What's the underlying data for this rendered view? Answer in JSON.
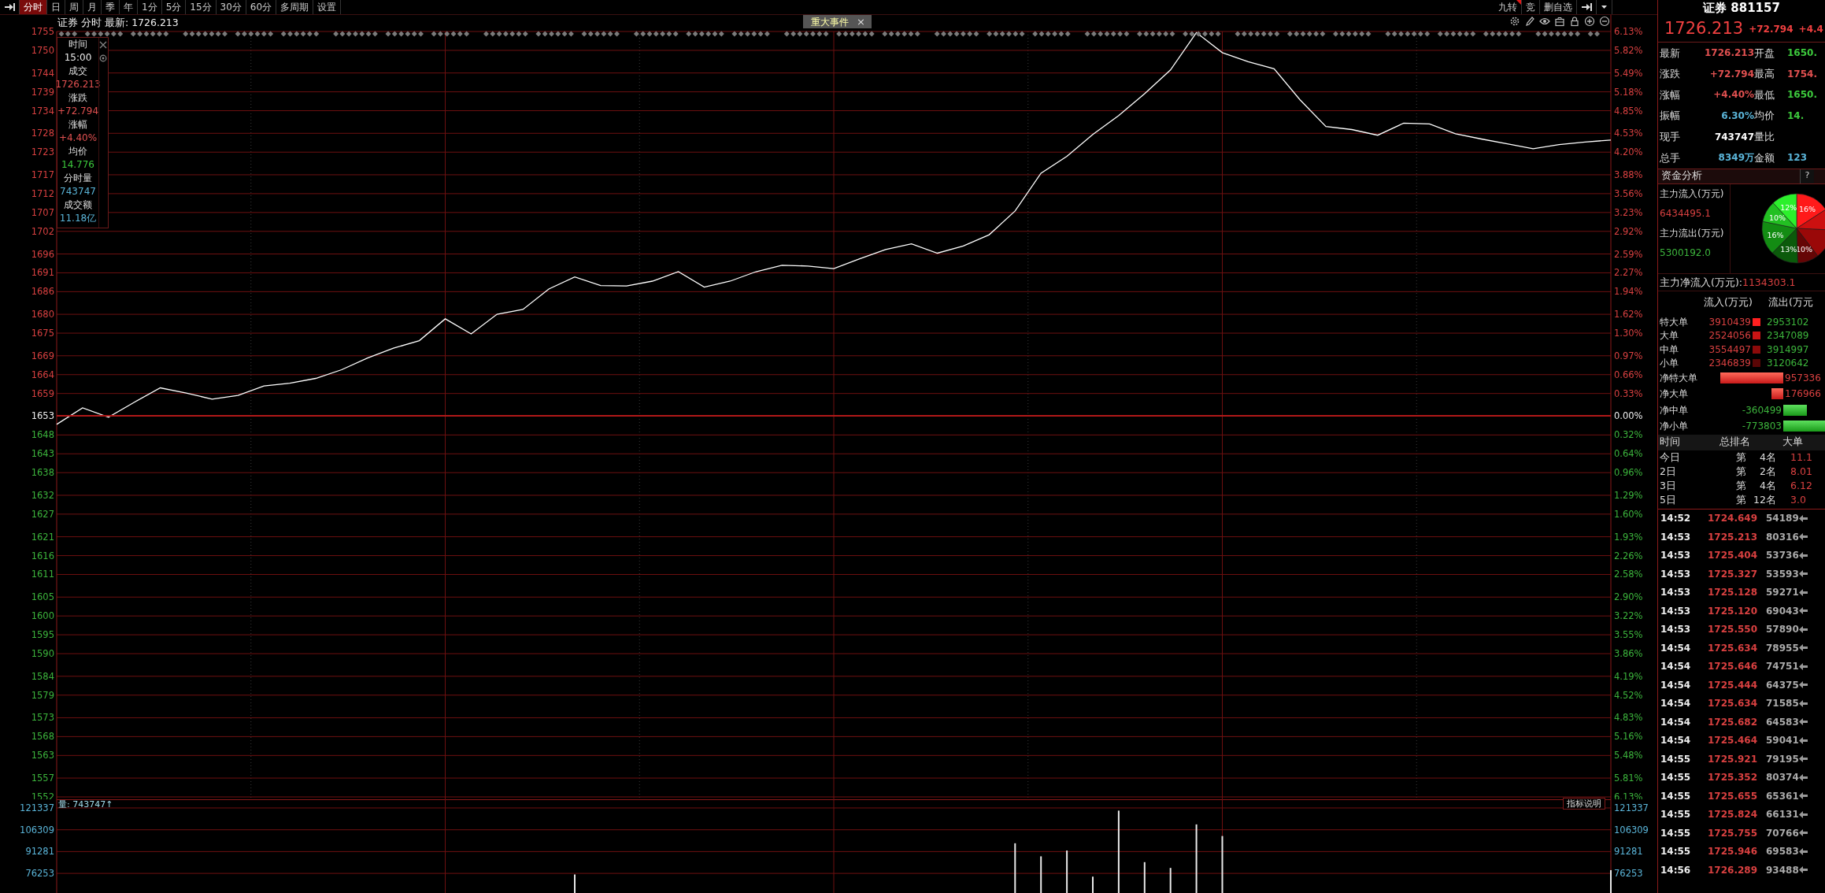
{
  "toolbar": {
    "tabs": [
      {
        "label": "分时",
        "selected": true
      },
      {
        "label": "日",
        "selected": false
      },
      {
        "label": "周",
        "selected": false
      },
      {
        "label": "月",
        "selected": false
      },
      {
        "label": "季",
        "selected": false
      },
      {
        "label": "年",
        "selected": false
      },
      {
        "label": "1分",
        "selected": false
      },
      {
        "label": "5分",
        "selected": false
      },
      {
        "label": "15分",
        "selected": false
      },
      {
        "label": "30分",
        "selected": false
      },
      {
        "label": "60分",
        "selected": false
      },
      {
        "label": "多周期",
        "selected": false
      },
      {
        "label": "设置",
        "selected": false
      }
    ],
    "right_buttons": [
      {
        "label": "九转",
        "flagged": true
      },
      {
        "label": "竞",
        "flagged": false
      },
      {
        "label": "删自选",
        "flagged": false
      }
    ]
  },
  "chart": {
    "title": "证券 分时 最新: 1726.213",
    "event_tag": {
      "label": "重大事件",
      "close": "×"
    },
    "tooltip": {
      "items": [
        {
          "label": "时间",
          "value": "15:00",
          "color": "#e8e8e8"
        },
        {
          "label": "成交",
          "value": "1726.213",
          "color": "#e05050"
        },
        {
          "label": "涨跌",
          "value": "+72.794",
          "color": "#e05050"
        },
        {
          "label": "涨幅",
          "value": "+4.40%",
          "color": "#e05050"
        },
        {
          "label": "均价",
          "value": "14.776",
          "color": "#3cc83c"
        },
        {
          "label": "分时量",
          "value": "743747",
          "color": "#5ab4d8"
        },
        {
          "label": "成交额",
          "value": "11.18亿",
          "color": "#5ab4d8"
        }
      ]
    },
    "percent_labels": [
      "6.13%",
      "5.82%",
      "5.49%",
      "5.18%",
      "4.85%",
      "4.53%",
      "4.20%",
      "3.88%",
      "3.56%",
      "3.23%",
      "2.92%",
      "2.59%",
      "2.27%",
      "1.94%",
      "1.62%",
      "1.30%",
      "0.97%",
      "0.66%",
      "0.33%",
      "0.00%",
      "0.32%",
      "0.64%",
      "0.96%",
      "1.29%",
      "1.60%",
      "1.93%",
      "2.26%",
      "2.58%",
      "2.90%",
      "3.22%",
      "3.55%",
      "3.86%",
      "4.19%",
      "4.52%",
      "4.83%",
      "5.16%",
      "5.48%",
      "5.81%",
      "6.13%"
    ],
    "chart_data": {
      "type": "line",
      "ylim": [
        1552,
        1755
      ],
      "yticks": [
        1755,
        1750,
        1744,
        1739,
        1734,
        1728,
        1723,
        1717,
        1712,
        1707,
        1702,
        1696,
        1691,
        1686,
        1680,
        1675,
        1669,
        1664,
        1659,
        1653,
        1648,
        1643,
        1638,
        1632,
        1627,
        1621,
        1616,
        1611,
        1605,
        1600,
        1595,
        1590,
        1584,
        1579,
        1573,
        1568,
        1563,
        1557,
        1552
      ],
      "grid": true,
      "categories": [
        null,
        null,
        null,
        null,
        null,
        null,
        null,
        null,
        null,
        null,
        null,
        null,
        null,
        null,
        null,
        null,
        null,
        null,
        null,
        null,
        null,
        null,
        null,
        null,
        null,
        null,
        null,
        null,
        null,
        null,
        null,
        null,
        null,
        null,
        null,
        null,
        null,
        null,
        null,
        null,
        null,
        null,
        null,
        null,
        null,
        null,
        null,
        null,
        null,
        null,
        null,
        null,
        null,
        null,
        null,
        null,
        null,
        null,
        null,
        null,
        null
      ],
      "series": [
        {
          "color": "#ffffff",
          "values": [
            1650.8,
            1655.2,
            1652.7,
            1656.7,
            1660.5,
            1659.1,
            1657.5,
            1658.5,
            1661.0,
            1661.7,
            1663.0,
            1665.3,
            1668.4,
            1671.0,
            1673.0,
            1678.8,
            1674.8,
            1680.0,
            1681.3,
            1686.7,
            1689.9,
            1687.6,
            1687.5,
            1688.8,
            1691.3,
            1687.2,
            1688.8,
            1691.3,
            1693.0,
            1692.8,
            1692.1,
            1694.7,
            1697.2,
            1698.7,
            1696.2,
            1698.1,
            1701.1,
            1707.4,
            1717.4,
            1721.9,
            1727.7,
            1732.7,
            1738.5,
            1744.8,
            1754.7,
            1749.4,
            1747.0,
            1745.1,
            1736.9,
            1729.8,
            1729.0,
            1727.5,
            1730.7,
            1730.5,
            1727.9,
            1726.5,
            1725.2,
            1723.9,
            1725.0,
            1725.7,
            1726.2
          ]
        }
      ]
    }
  },
  "volume": {
    "label": "量: 743747↑",
    "help_button": "指标说明",
    "right_labels": [
      "121337",
      "106309",
      "91281",
      "76253"
    ],
    "chart_data": {
      "type": "bar",
      "grid": true,
      "ylim": [
        62735,
        127305
      ],
      "yticks": [
        121337,
        106309,
        91281,
        76253
      ],
      "categories": [
        null,
        null,
        null,
        null,
        null,
        null,
        null,
        null,
        null,
        null,
        null,
        null,
        null,
        null,
        null,
        null,
        null,
        null,
        null,
        null,
        null,
        null,
        null,
        null,
        null,
        null,
        null,
        null,
        null,
        null,
        null,
        null,
        null,
        null,
        null,
        null,
        null,
        null,
        null,
        null,
        null,
        null,
        null,
        null,
        null,
        null,
        null,
        null,
        null,
        null,
        null,
        null,
        null,
        null,
        null,
        null,
        null,
        null,
        null,
        null,
        null
      ],
      "values": [
        null,
        null,
        null,
        null,
        null,
        null,
        null,
        null,
        null,
        null,
        null,
        null,
        null,
        null,
        null,
        null,
        null,
        null,
        null,
        null,
        75500,
        null,
        null,
        null,
        null,
        null,
        null,
        null,
        null,
        null,
        null,
        null,
        null,
        null,
        null,
        null,
        null,
        97000,
        88000,
        92000,
        74000,
        119500,
        84000,
        80000,
        110000,
        102000,
        null,
        null,
        null,
        null,
        null,
        null,
        null,
        null,
        null,
        null,
        null,
        null,
        null,
        null,
        78500
      ]
    }
  },
  "quote": {
    "name": "证券 881157",
    "price": "1726.213",
    "change": "+72.794",
    "change_pct": "+4.4",
    "left": [
      {
        "label": "最新",
        "value": "1726.213",
        "color": "#e05050"
      },
      {
        "label": "涨跌",
        "value": "+72.794",
        "color": "#e05050"
      },
      {
        "label": "涨幅",
        "value": "+4.40%",
        "color": "#e05050"
      },
      {
        "label": "振幅",
        "value": "6.30%",
        "color": "#5ab4d8"
      },
      {
        "label": "现手",
        "value": "743747",
        "color": "#ffffff"
      },
      {
        "label": "总手",
        "value": "8349万",
        "color": "#5ab4d8"
      }
    ],
    "right": [
      {
        "label": "开盘",
        "value": "1650.",
        "color": "#3cc83c"
      },
      {
        "label": "最高",
        "value": "1754.",
        "color": "#e05050"
      },
      {
        "label": "最低",
        "value": "1650.",
        "color": "#3cc83c"
      },
      {
        "label": "均价",
        "value": "14.",
        "color": "#3cc83c"
      },
      {
        "label": "量比"
      },
      {
        "label": "金额",
        "value": "123",
        "color": "#5ab4d8"
      }
    ]
  },
  "fund_flow": {
    "title": "资金分析",
    "help": "?",
    "inflow_label": "主力流入(万元)",
    "inflow": "6434495.1",
    "outflow_label": "主力流出(万元)",
    "outflow": "5300192.0",
    "chart_data": {
      "type": "pie",
      "values": [
        16,
        10,
        14,
        10,
        13,
        16,
        10,
        12
      ],
      "colors": [
        "#ff1a1a",
        "#cc1010",
        "#9a0808",
        "#650505",
        "#0b5a0b",
        "#138c13",
        "#22c022",
        "#2cf02c"
      ],
      "value_labels": [
        "16%",
        null,
        null,
        "10%",
        "13%",
        "16%",
        "10%",
        "12%"
      ]
    },
    "net_label": "主力净流入(万元):",
    "net": "1134303.1",
    "orders": {
      "columns": [
        "流入(万元)",
        "流出(万元"
      ],
      "rows": [
        {
          "label": "特大单",
          "in": "3910439",
          "out": "2953102",
          "color": "#ff2020"
        },
        {
          "label": "大单",
          "in": "2524056",
          "out": "2347089",
          "color": "#c81414"
        },
        {
          "label": "中单",
          "in": "3554497",
          "out": "3914997",
          "color": "#8c0a0a"
        },
        {
          "label": "小单",
          "in": "2346839",
          "out": "3120642",
          "color": "#5a0606"
        }
      ]
    },
    "net_rows": [
      {
        "label": "净特大单",
        "value": "957336",
        "kind": "inflow"
      },
      {
        "label": "净大单",
        "value": "176966",
        "kind": "inflow"
      },
      {
        "label": "净中单",
        "value": "-360499",
        "kind": "outflow"
      },
      {
        "label": "净小单",
        "value": "-773803",
        "kind": "outflow"
      }
    ]
  },
  "ranking": {
    "columns": [
      "时间",
      "总排名",
      "大单"
    ],
    "rows": [
      {
        "period": "今日",
        "prefix": "第",
        "rank": "4名",
        "value": "11.1"
      },
      {
        "period": "2日",
        "prefix": "第",
        "rank": "2名",
        "value": "8.01"
      },
      {
        "period": "3日",
        "prefix": "第",
        "rank": "4名",
        "value": "6.12"
      },
      {
        "period": "5日",
        "prefix": "第",
        "rank": "12名",
        "value": "3.0"
      }
    ]
  },
  "ticks": [
    {
      "time": "14:52",
      "price": "1724.649",
      "volume": "54189"
    },
    {
      "time": "14:53",
      "price": "1725.213",
      "volume": "80316"
    },
    {
      "time": "14:53",
      "price": "1725.404",
      "volume": "53736"
    },
    {
      "time": "14:53",
      "price": "1725.327",
      "volume": "53593"
    },
    {
      "time": "14:53",
      "price": "1725.128",
      "volume": "59271"
    },
    {
      "time": "14:53",
      "price": "1725.120",
      "volume": "69043"
    },
    {
      "time": "14:53",
      "price": "1725.550",
      "volume": "57890"
    },
    {
      "time": "14:54",
      "price": "1725.634",
      "volume": "78955"
    },
    {
      "time": "14:54",
      "price": "1725.646",
      "volume": "74751"
    },
    {
      "time": "14:54",
      "price": "1725.444",
      "volume": "64375"
    },
    {
      "time": "14:54",
      "price": "1725.634",
      "volume": "71585"
    },
    {
      "time": "14:54",
      "price": "1725.682",
      "volume": "64583"
    },
    {
      "time": "14:54",
      "price": "1725.464",
      "volume": "59041"
    },
    {
      "time": "14:55",
      "price": "1725.921",
      "volume": "79195"
    },
    {
      "time": "14:55",
      "price": "1725.352",
      "volume": "80374"
    },
    {
      "time": "14:55",
      "price": "1725.655",
      "volume": "65361"
    },
    {
      "time": "14:55",
      "price": "1725.824",
      "volume": "66131"
    },
    {
      "time": "14:55",
      "price": "1725.755",
      "volume": "70766"
    },
    {
      "time": "14:55",
      "price": "1725.946",
      "volume": "69583"
    },
    {
      "time": "14:56",
      "price": "1726.289",
      "volume": "93488"
    }
  ]
}
